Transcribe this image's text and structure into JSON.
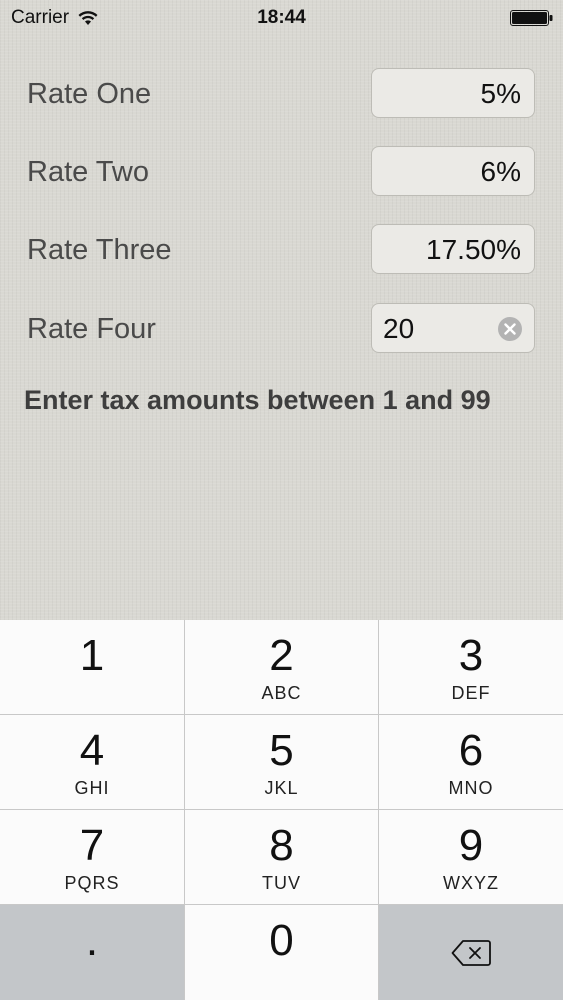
{
  "status_bar": {
    "carrier": "Carrier",
    "time": "18:44"
  },
  "form": {
    "rates": [
      {
        "label": "Rate One",
        "value": "5%"
      },
      {
        "label": "Rate Two",
        "value": "6%"
      },
      {
        "label": "Rate Three",
        "value": "17.50%"
      },
      {
        "label": "Rate Four",
        "value": "20"
      }
    ],
    "hint": "Enter tax amounts between 1 and 99"
  },
  "keypad": {
    "keys": [
      {
        "digit": "1",
        "letters": ""
      },
      {
        "digit": "2",
        "letters": "ABC"
      },
      {
        "digit": "3",
        "letters": "DEF"
      },
      {
        "digit": "4",
        "letters": "GHI"
      },
      {
        "digit": "5",
        "letters": "JKL"
      },
      {
        "digit": "6",
        "letters": "MNO"
      },
      {
        "digit": "7",
        "letters": "PQRS"
      },
      {
        "digit": "8",
        "letters": "TUV"
      },
      {
        "digit": "9",
        "letters": "WXYZ"
      }
    ],
    "decimal": ".",
    "zero": "0"
  },
  "icons": {
    "wifi": "wifi-icon",
    "battery": "battery-icon",
    "clear": "clear-icon",
    "delete": "delete-icon"
  },
  "colors": {
    "background": "#d9d8d2",
    "field": "#ebeae6",
    "keypad": "#fbfbfb",
    "keypad_gray": "#c3c6c9"
  }
}
